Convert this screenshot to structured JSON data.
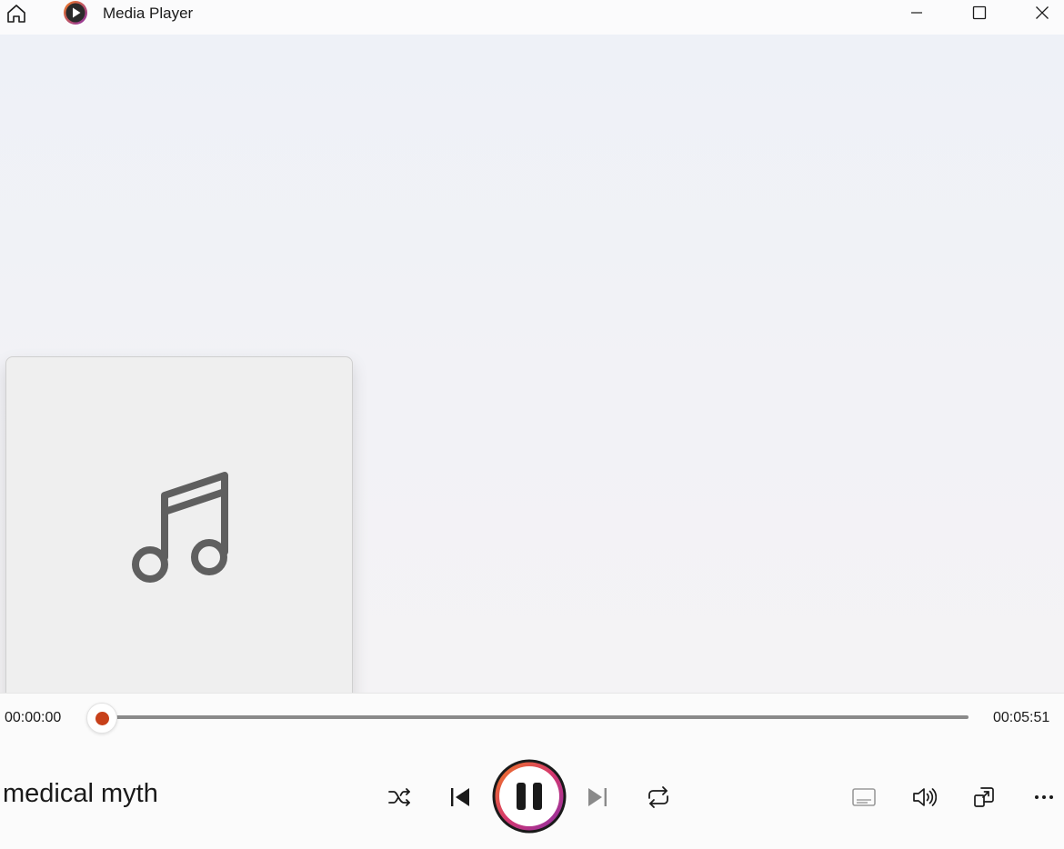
{
  "app": {
    "title": "Media Player"
  },
  "window_controls": {
    "icons": [
      "home-icon",
      "minimize-icon",
      "maximize-icon",
      "close-icon"
    ]
  },
  "album_art": {
    "icon": "music-note-icon"
  },
  "playback": {
    "current_time": "00:00:00",
    "total_time": "00:05:51",
    "progress": 0.0,
    "track_title": "medical myth",
    "state": "playing"
  },
  "controls": {
    "icons": [
      "shuffle-icon",
      "previous-icon",
      "pause-icon",
      "next-icon",
      "repeat-icon",
      "subtitles-icon",
      "volume-icon",
      "miniplayer-icon",
      "more-icon"
    ]
  },
  "colors": {
    "accent": "#c7401a",
    "play_ring_start": "#f07a1f",
    "play_ring_end": "#8a2fa8"
  }
}
